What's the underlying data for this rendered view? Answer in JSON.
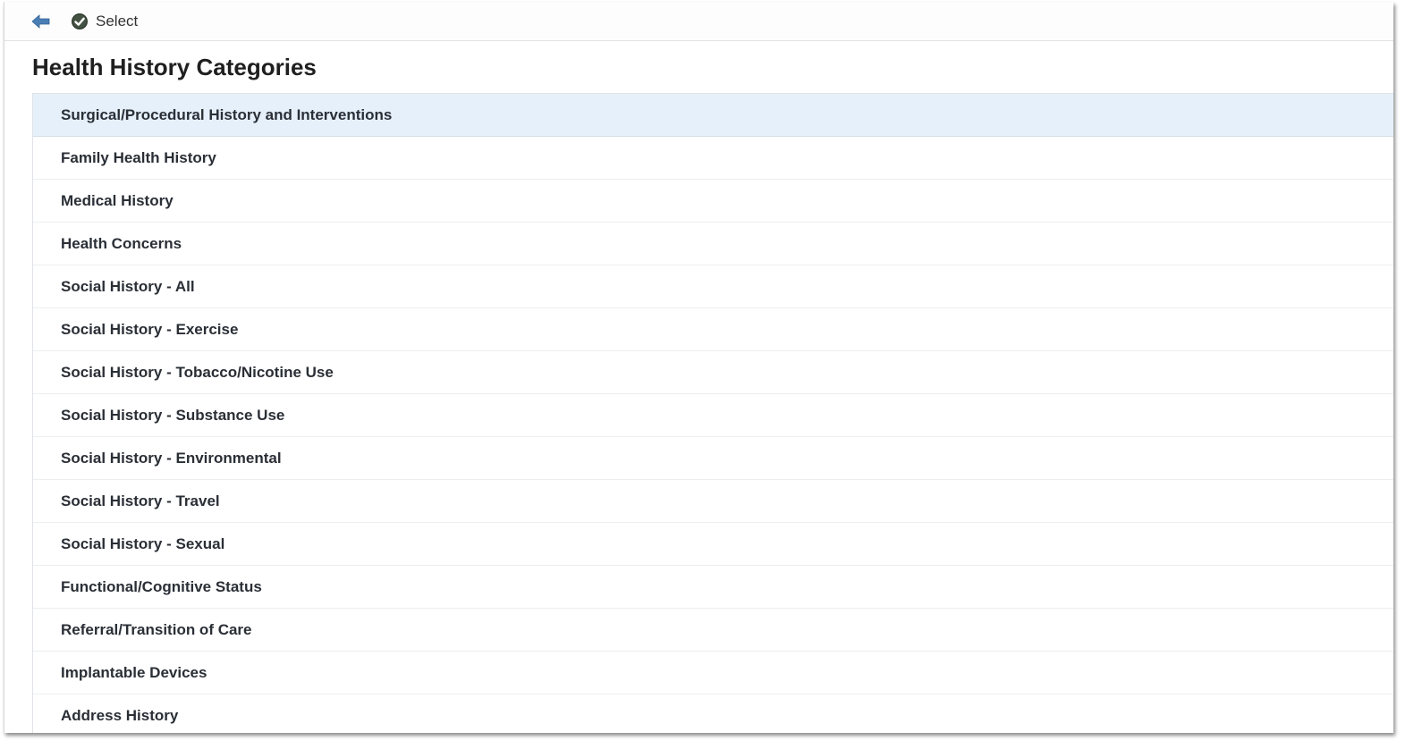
{
  "toolbar": {
    "back_icon": "back-arrow-icon",
    "select_icon": "check-circle-icon",
    "select_label": "Select"
  },
  "page": {
    "title": "Health History Categories"
  },
  "categories": {
    "selected_index": 0,
    "items": [
      {
        "label": "Surgical/Procedural History and Interventions"
      },
      {
        "label": "Family Health History"
      },
      {
        "label": "Medical History"
      },
      {
        "label": "Health Concerns"
      },
      {
        "label": "Social History - All"
      },
      {
        "label": "Social History - Exercise"
      },
      {
        "label": "Social History - Tobacco/Nicotine Use"
      },
      {
        "label": "Social History - Substance Use"
      },
      {
        "label": "Social History - Environmental"
      },
      {
        "label": "Social History - Travel"
      },
      {
        "label": "Social History - Sexual"
      },
      {
        "label": "Functional/Cognitive Status"
      },
      {
        "label": "Referral/Transition of Care"
      },
      {
        "label": "Implantable Devices"
      },
      {
        "label": "Address History"
      }
    ]
  },
  "colors": {
    "selected_row": "#e6f0fb",
    "back_arrow": "#4a7fb5",
    "check_icon": "#2e3b2e"
  }
}
